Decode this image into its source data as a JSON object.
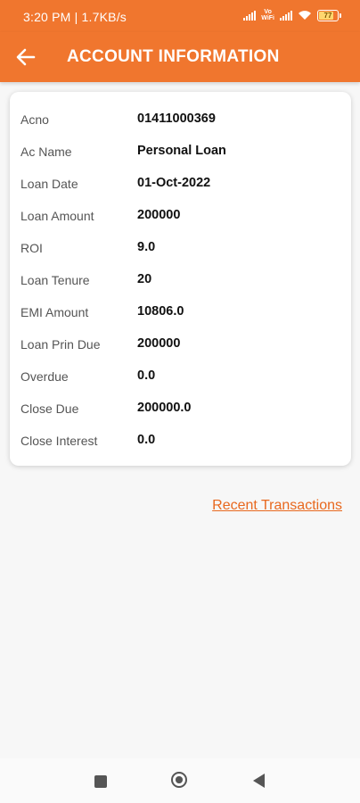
{
  "status_bar": {
    "time": "3:20 PM | 1.7KB/s",
    "battery": "77"
  },
  "app_bar": {
    "title": "ACCOUNT INFORMATION"
  },
  "account": {
    "rows": [
      {
        "label": "Acno",
        "value": "01411000369"
      },
      {
        "label": "Ac Name",
        "value": "Personal Loan"
      },
      {
        "label": "Loan Date",
        "value": "01-Oct-2022"
      },
      {
        "label": "Loan Amount",
        "value": "200000"
      },
      {
        "label": "ROI",
        "value": "9.0"
      },
      {
        "label": "Loan Tenure",
        "value": "20"
      },
      {
        "label": "EMI Amount",
        "value": "10806.0"
      },
      {
        "label": "Loan Prin Due",
        "value": "200000"
      },
      {
        "label": "Overdue",
        "value": "0.0"
      },
      {
        "label": "Close Due",
        "value": "200000.0"
      },
      {
        "label": "Close Interest",
        "value": "0.0"
      }
    ]
  },
  "links": {
    "recent_transactions": "Recent Transactions"
  },
  "colors": {
    "accent": "#f0762e",
    "link": "#e8681e"
  },
  "icons": {
    "back": "arrow-left-icon",
    "nav_recent": "square-icon",
    "nav_home": "circle-icon",
    "nav_back": "triangle-back-icon"
  }
}
